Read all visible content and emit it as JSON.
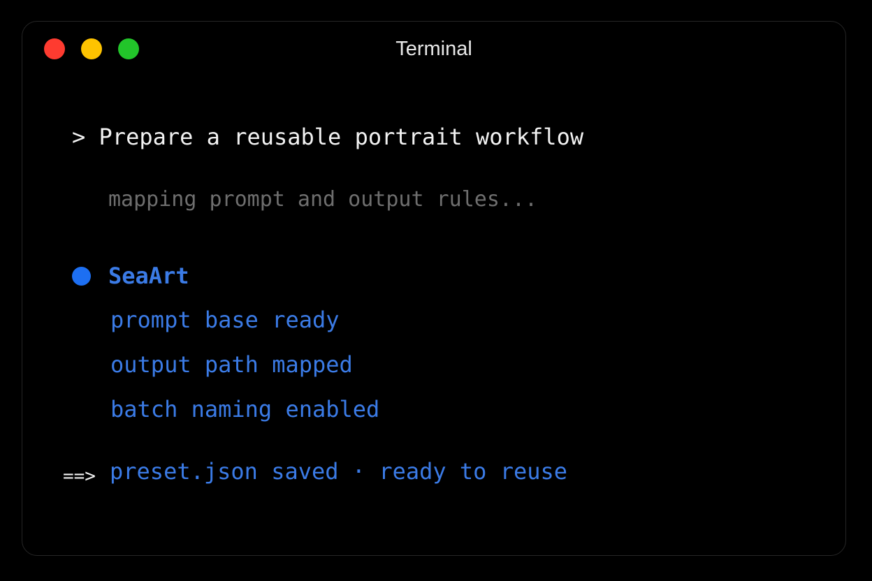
{
  "window": {
    "title": "Terminal",
    "controls": {
      "close_color": "#fe3b30",
      "minimize_color": "#fec300",
      "zoom_color": "#22c52a"
    }
  },
  "terminal": {
    "command": "> Prepare a reusable portrait workflow",
    "status": "mapping prompt and output rules...",
    "section": {
      "bullet_color": "#1d6ff2",
      "title": "SeaArt",
      "items": [
        "prompt base ready",
        "output path mapped",
        "batch naming enabled"
      ]
    },
    "result": {
      "arrow": "==>",
      "text": "preset.json saved · ready to reuse"
    },
    "accent_color": "#3b7be6"
  }
}
